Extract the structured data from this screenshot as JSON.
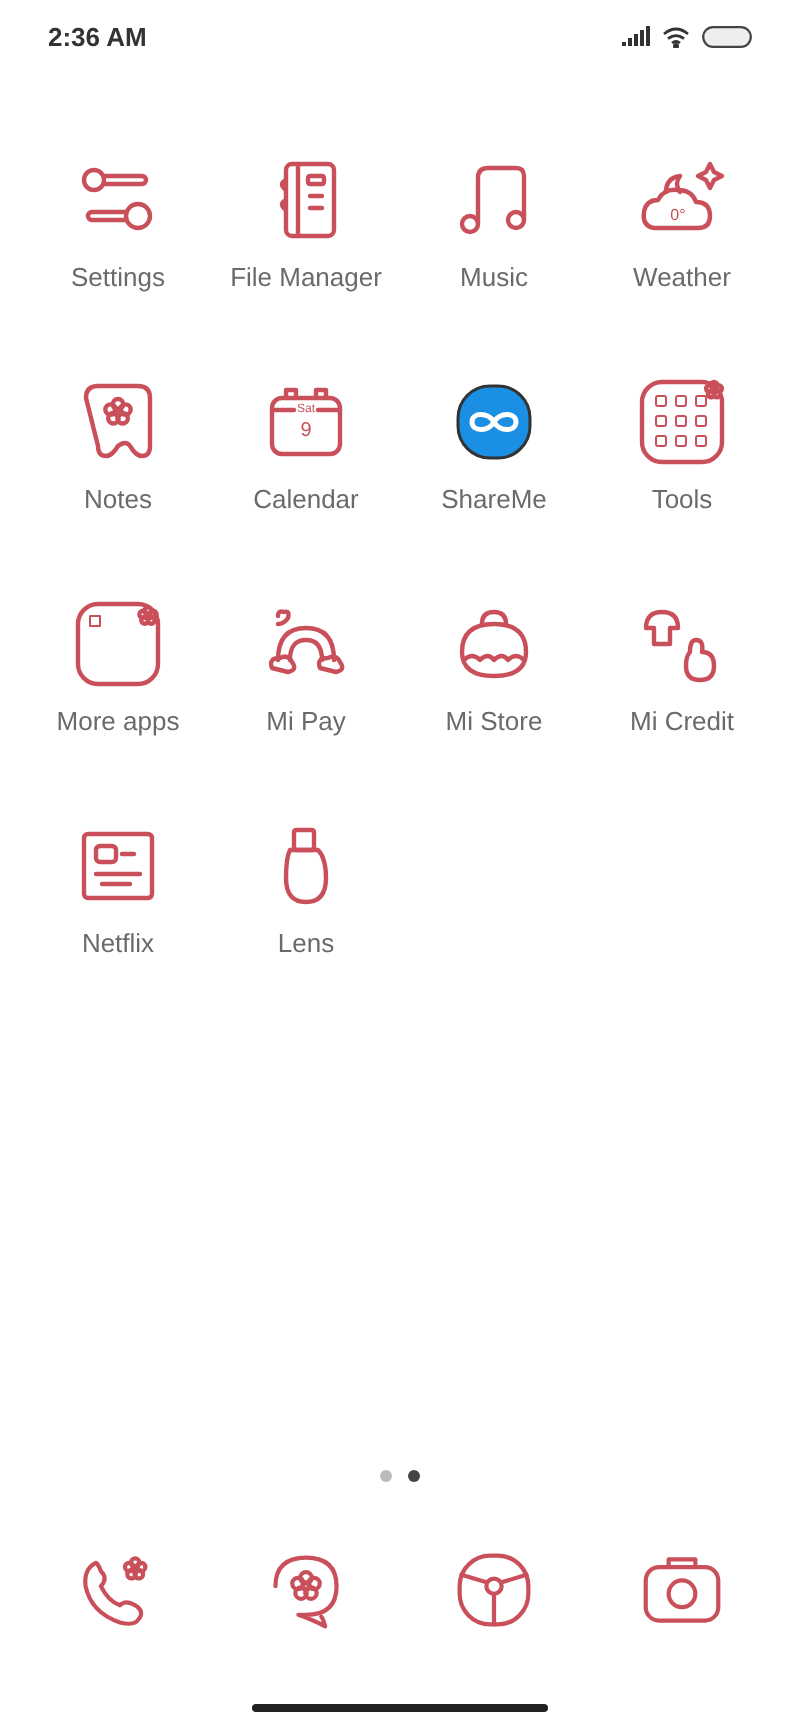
{
  "status_bar": {
    "time": "2:36 AM"
  },
  "apps": [
    {
      "label": "Settings",
      "kind": "settings"
    },
    {
      "label": "File Manager",
      "kind": "files"
    },
    {
      "label": "Music",
      "kind": "music"
    },
    {
      "label": "Weather",
      "kind": "weather",
      "icon_text": "0°"
    },
    {
      "label": "Notes",
      "kind": "notes"
    },
    {
      "label": "Calendar",
      "kind": "calendar",
      "icon_day": "Sat",
      "icon_date": "9"
    },
    {
      "label": "ShareMe",
      "kind": "shareme"
    },
    {
      "label": "Tools",
      "kind": "folder_full"
    },
    {
      "label": "More apps",
      "kind": "folder"
    },
    {
      "label": "Mi Pay",
      "kind": "rainbow"
    },
    {
      "label": "Mi Store",
      "kind": "bag"
    },
    {
      "label": "Mi Credit",
      "kind": "mushroom"
    },
    {
      "label": "Netflix",
      "kind": "document"
    },
    {
      "label": "Lens",
      "kind": "bottle"
    }
  ],
  "page_dots": [
    {
      "selected": false
    },
    {
      "selected": true
    }
  ],
  "dock": [
    {
      "kind": "phone"
    },
    {
      "kind": "chat"
    },
    {
      "kind": "wheel"
    },
    {
      "kind": "camera"
    }
  ]
}
